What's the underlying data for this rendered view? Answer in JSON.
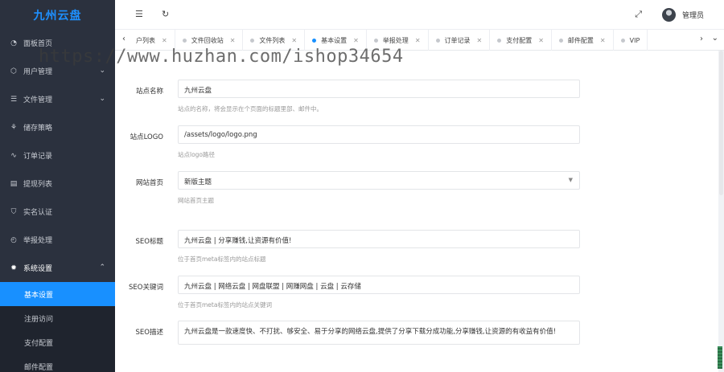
{
  "sidebar": {
    "logo": "九州云盘",
    "items": [
      {
        "label": "面板首页",
        "icon": "dashboard-icon"
      },
      {
        "label": "用户管理",
        "icon": "user-icon",
        "has_children": true
      },
      {
        "label": "文件管理",
        "icon": "file-stack-icon",
        "has_children": true
      },
      {
        "label": "储存策略",
        "icon": "storage-icon"
      },
      {
        "label": "订单记录",
        "icon": "pulse-icon"
      },
      {
        "label": "提现列表",
        "icon": "withdraw-icon"
      },
      {
        "label": "实名认证",
        "icon": "shield-check-icon"
      },
      {
        "label": "举报处理",
        "icon": "report-icon"
      },
      {
        "label": "系统设置",
        "icon": "gear-icon",
        "has_children": true,
        "open": true
      }
    ],
    "submenu": [
      {
        "label": "基本设置",
        "active": true
      },
      {
        "label": "注册访问"
      },
      {
        "label": "支付配置"
      },
      {
        "label": "邮件配置"
      }
    ]
  },
  "header": {
    "admin_name": "管理员"
  },
  "tabs": [
    {
      "label": "户列表",
      "active": false,
      "partial": true
    },
    {
      "label": "文件回收站",
      "active": false
    },
    {
      "label": "文件列表",
      "active": false
    },
    {
      "label": "基本设置",
      "active": true
    },
    {
      "label": "举报处理",
      "active": false
    },
    {
      "label": "订单记录",
      "active": false
    },
    {
      "label": "支付配置",
      "active": false
    },
    {
      "label": "邮件配置",
      "active": false
    },
    {
      "label": "VIP",
      "active": false,
      "partial": true
    }
  ],
  "form": {
    "site_name": {
      "label": "站点名称",
      "value": "九州云盘",
      "help": "站点的名称，将会显示在个页面的标题里部、邮件中。"
    },
    "site_logo": {
      "label": "站点LOGO",
      "value": "/assets/logo/logo.png",
      "help": "站点logo路径"
    },
    "home_theme": {
      "label": "网站首页",
      "value": "新版主题",
      "help": "网站首页主题"
    },
    "seo_title": {
      "label": "SEO标题",
      "value": "九州云盘 | 分享赚钱,让资源有价值!",
      "help": "位于首页meta标签内的站点标题"
    },
    "seo_keywords": {
      "label": "SEO关键词",
      "value": "九州云盘 | 网络云盘 | 网盘联盟 | 网赚网盘 | 云盘 | 云存储",
      "help": "位于首页meta标签内的站点关键词"
    },
    "seo_desc": {
      "label": "SEO描述",
      "value": "九州云盘是一款速度快、不打扰、够安全、易于分享的网络云盘,提供了分享下载分成功能,分享赚钱,让资源的有收益有价值!"
    }
  },
  "watermark": "https://www.huzhan.com/ishop34654"
}
